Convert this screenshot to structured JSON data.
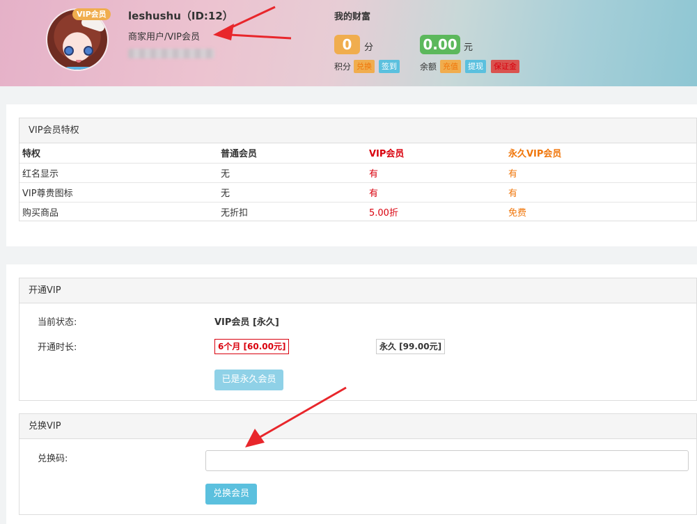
{
  "user": {
    "vip_badge": "VIP会员",
    "name": "leshushu（ID:12）",
    "type": "商家用户/VIP会员"
  },
  "wealth": {
    "title": "我的财富",
    "points_value": "0",
    "points_unit": "分",
    "points_label": "积分",
    "exchange_label": "兑换",
    "checkin_label": "签到",
    "balance_value": "0.00",
    "balance_unit": "元",
    "balance_label": "余额",
    "recharge_label": "充值",
    "withdraw_label": "提现",
    "deposit_label": "保证金"
  },
  "privileges": {
    "title": "VIP会员特权",
    "headers": [
      "特权",
      "普通会员",
      "VIP会员",
      "永久VIP会员"
    ],
    "rows": [
      [
        "红名显示",
        "无",
        "有",
        "有"
      ],
      [
        "VIP尊贵图标",
        "无",
        "有",
        "有"
      ],
      [
        "购买商品",
        "无折扣",
        "5.00折",
        "免费"
      ]
    ]
  },
  "open_vip": {
    "title": "开通VIP",
    "status_label": "当前状态:",
    "status_value": "VIP会员 [永久]",
    "duration_label": "开通时长:",
    "option_6m": "6个月 [60.00元]",
    "option_forever": "永久 [99.00元]",
    "button": "已是永久会员"
  },
  "redeem_vip": {
    "title": "兑换VIP",
    "code_label": "兑换码:",
    "code_value": "",
    "button": "兑换会员"
  },
  "colors": {
    "orange": "#f0ad4e",
    "green": "#5cb85c",
    "blue": "#5bc0de",
    "red": "#d9534f",
    "vip_red": "#d9000d",
    "forever_orange": "#f0760a"
  }
}
